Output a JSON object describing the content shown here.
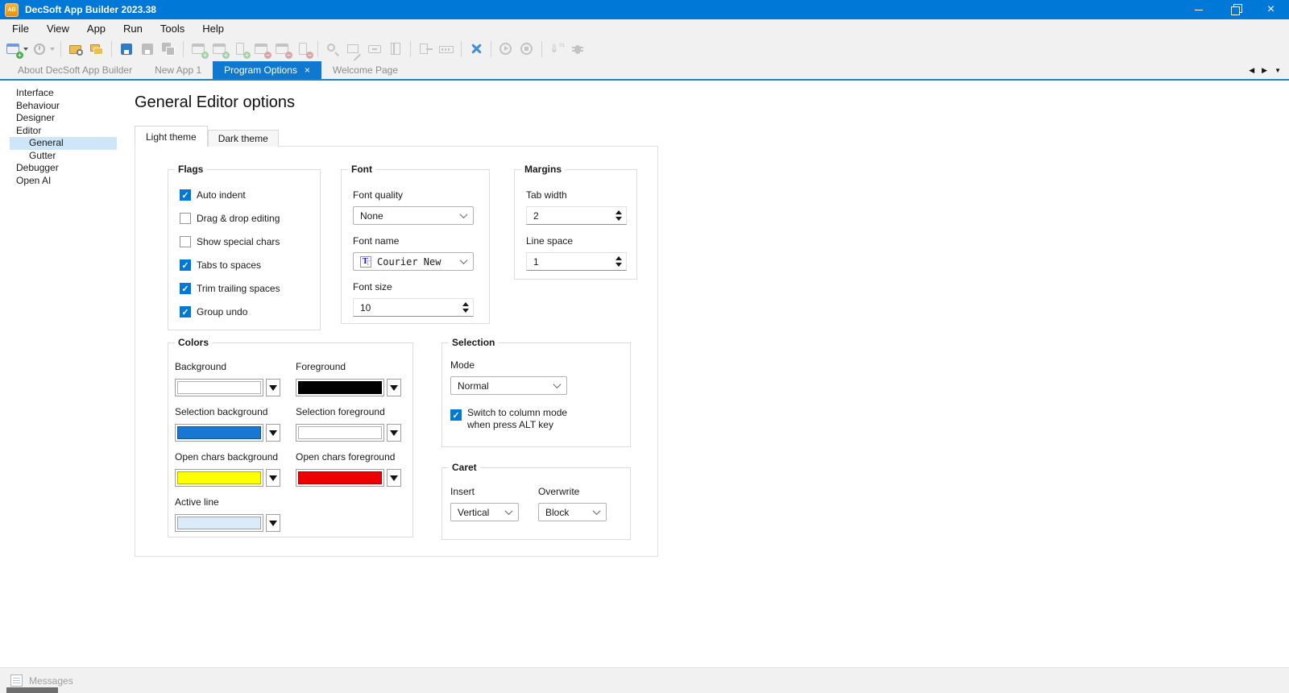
{
  "window": {
    "title": "DecSoft App Builder 2023.38",
    "app_icon_text": "AB"
  },
  "icons": {
    "close": "×",
    "tab_close": "×",
    "check": "✓",
    "nav_left": "◀",
    "nav_right": "▶",
    "nav_menu": "▼"
  },
  "colors": {
    "accent": "#0078d7",
    "tab_underline": "#1d85c3",
    "selected_tree_item": "#cfe6f8"
  },
  "menu": {
    "items": [
      "File",
      "View",
      "App",
      "Run",
      "Tools",
      "Help"
    ]
  },
  "toolbar": {
    "groups": [
      [
        {
          "name": "new-app-button",
          "icon": "window",
          "color": "#6f9bd8",
          "badge": "+",
          "badge_color": "#4caf50",
          "enabled": true,
          "dropdown": true
        },
        {
          "name": "recent-apps-button",
          "icon": "clock",
          "color": "#b5b5b5",
          "enabled": false,
          "dropdown": true
        }
      ],
      [
        {
          "name": "open-app-button",
          "icon": "folder-search",
          "color": "#edbd55",
          "enabled": true
        },
        {
          "name": "open-app-folder-button",
          "icon": "folders",
          "color": "#edbd55",
          "enabled": true
        }
      ],
      [
        {
          "name": "save-file-button",
          "icon": "floppy",
          "color": "#2f7cc4",
          "enabled": true
        },
        {
          "name": "save-file-as-button",
          "icon": "floppy",
          "color": "#bdbdbd",
          "enabled": false
        },
        {
          "name": "save-all-files-button",
          "icon": "floppies",
          "color": "#bdbdbd",
          "enabled": false
        }
      ],
      [
        {
          "name": "add-window-button",
          "icon": "window",
          "color": "#c3c3c3",
          "badge": "+",
          "badge_color": "#a5cfa5",
          "enabled": false
        },
        {
          "name": "add-dialog-button",
          "icon": "window",
          "color": "#c3c3c3",
          "badge": "+",
          "badge_color": "#a5cfa5",
          "enabled": false
        },
        {
          "name": "add-file-button",
          "icon": "page",
          "color": "#c3c3c3",
          "badge": "+",
          "badge_color": "#a5cfa5",
          "enabled": false
        },
        {
          "name": "remove-window-button",
          "icon": "window",
          "color": "#c3c3c3",
          "badge": "−",
          "badge_color": "#d9a5a5",
          "enabled": false
        },
        {
          "name": "remove-dialog-button",
          "icon": "window",
          "color": "#c3c3c3",
          "badge": "−",
          "badge_color": "#d9a5a5",
          "enabled": false
        },
        {
          "name": "remove-file-button",
          "icon": "page",
          "color": "#c3c3c3",
          "badge": "−",
          "badge_color": "#d9a5a5",
          "enabled": false
        }
      ],
      [
        {
          "name": "search-button",
          "icon": "magnifier",
          "color": "#c3c3c3",
          "enabled": false
        },
        {
          "name": "edit-form-button",
          "icon": "form-edit",
          "color": "#c3c3c3",
          "enabled": false
        },
        {
          "name": "archive-button",
          "icon": "drawer",
          "color": "#c3c3c3",
          "enabled": false
        },
        {
          "name": "help-book-button",
          "icon": "book",
          "color": "#c3c3c3",
          "enabled": false
        }
      ],
      [
        {
          "name": "export-app-button",
          "icon": "export",
          "color": "#c3c3c3",
          "enabled": false
        },
        {
          "name": "keyboard-shortcuts-button",
          "icon": "keyboard",
          "color": "#c3c3c3",
          "enabled": false
        }
      ],
      [
        {
          "name": "program-options-button",
          "icon": "tools",
          "color": "#3f8fd6",
          "enabled": true
        }
      ],
      [
        {
          "name": "run-app-button",
          "icon": "play",
          "color": "#c3c3c3",
          "enabled": false
        },
        {
          "name": "stop-app-button",
          "icon": "stop",
          "color": "#c3c3c3",
          "enabled": false
        }
      ],
      [
        {
          "name": "compile-app-button",
          "icon": "binary-download",
          "color": "#c3c3c3",
          "enabled": false
        },
        {
          "name": "debug-app-button",
          "icon": "bug",
          "color": "#c3c3c3",
          "enabled": false
        }
      ]
    ]
  },
  "tabs": {
    "items": [
      {
        "label": "About DecSoft App Builder",
        "active": false,
        "closable": false
      },
      {
        "label": "New App 1",
        "active": false,
        "closable": false
      },
      {
        "label": "Program Options",
        "active": true,
        "closable": true
      },
      {
        "label": "Welcome Page",
        "active": false,
        "closable": false
      }
    ]
  },
  "sidebar": {
    "items": [
      {
        "label": "Interface",
        "level": 0,
        "selected": false
      },
      {
        "label": "Behaviour",
        "level": 0,
        "selected": false
      },
      {
        "label": "Designer",
        "level": 0,
        "selected": false
      },
      {
        "label": "Editor",
        "level": 0,
        "selected": false
      },
      {
        "label": "General",
        "level": 1,
        "selected": true
      },
      {
        "label": "Gutter",
        "level": 1,
        "selected": false
      },
      {
        "label": "Debugger",
        "level": 0,
        "selected": false
      },
      {
        "label": "Open AI",
        "level": 0,
        "selected": false
      }
    ]
  },
  "main": {
    "title": "General Editor options",
    "theme_tabs": [
      {
        "label": "Light theme",
        "active": true
      },
      {
        "label": "Dark theme",
        "active": false
      }
    ],
    "groups": {
      "flags": {
        "title": "Flags",
        "checkboxes": [
          {
            "label": "Auto indent",
            "checked": true
          },
          {
            "label": "Drag & drop editing",
            "checked": false
          },
          {
            "label": "Show special chars",
            "checked": false
          },
          {
            "label": "Tabs to spaces",
            "checked": true
          },
          {
            "label": "Trim trailing spaces",
            "checked": true
          },
          {
            "label": "Group undo",
            "checked": true
          }
        ]
      },
      "font": {
        "title": "Font",
        "quality_label": "Font quality",
        "quality_value": "None",
        "name_label": "Font name",
        "name_value": "Courier New",
        "size_label": "Font size",
        "size_value": "10"
      },
      "margins": {
        "title": "Margins",
        "tab_width_label": "Tab width",
        "tab_width_value": "2",
        "line_space_label": "Line space",
        "line_space_value": "1"
      },
      "colors": {
        "title": "Colors",
        "swatches": [
          {
            "label": "Background",
            "color": "#ffffff",
            "col": 1
          },
          {
            "label": "Foreground",
            "color": "#000000",
            "col": 2
          },
          {
            "label": "Selection background",
            "color": "#1777d2",
            "col": 1
          },
          {
            "label": "Selection foreground",
            "color": "#ffffff",
            "col": 2
          },
          {
            "label": "Open chars background",
            "color": "#ffff00",
            "col": 1
          },
          {
            "label": "Open chars foreground",
            "color": "#ee0000",
            "col": 2
          },
          {
            "label": "Active line",
            "color": "#dcebfa",
            "col": 1
          }
        ]
      },
      "selection": {
        "title": "Selection",
        "mode_label": "Mode",
        "mode_value": "Normal",
        "checkbox": {
          "label_line1": "Switch to column mode",
          "label_line2": "when press ALT key",
          "checked": true
        }
      },
      "caret": {
        "title": "Caret",
        "insert_label": "Insert",
        "insert_value": "Vertical",
        "overwrite_label": "Overwrite",
        "overwrite_value": "Block"
      }
    }
  },
  "statusbar": {
    "messages_label": "Messages"
  }
}
